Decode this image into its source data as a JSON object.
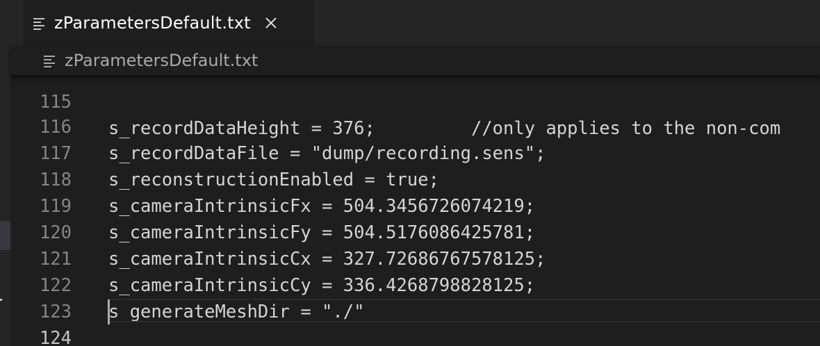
{
  "tab": {
    "label": "zParametersDefault.txt",
    "icon": "text-file-icon"
  },
  "breadcrumb": {
    "label": "zParametersDefault.txt",
    "icon": "text-file-icon"
  },
  "editor": {
    "current_line": "124",
    "lines": [
      {
        "number": "115",
        "text": "s_recordDataHeight = 376;         //only applies to the non-com"
      },
      {
        "number": "116",
        "text": "s_recordDataFile = \"dump/recording.sens\";"
      },
      {
        "number": "117",
        "text": "s_reconstructionEnabled = true;"
      },
      {
        "number": "118",
        "text": "s_cameraIntrinsicFx = 504.3456726074219;"
      },
      {
        "number": "119",
        "text": "s_cameraIntrinsicFy = 504.5176086425781;"
      },
      {
        "number": "120",
        "text": "s_cameraIntrinsicCx = 327.72686767578125;"
      },
      {
        "number": "121",
        "text": "s_cameraIntrinsicCy = 336.4268798828125;"
      },
      {
        "number": "122",
        "text": "s_generateMeshDir = \"./\""
      },
      {
        "number": "123",
        "text": ""
      },
      {
        "number": "124",
        "text": ""
      }
    ]
  },
  "colors": {
    "background": "#1e1e1e",
    "tab_bar": "#252526",
    "text": "#d4d4d4",
    "line_number": "#858585",
    "active_line_number": "#c6c6c6"
  }
}
